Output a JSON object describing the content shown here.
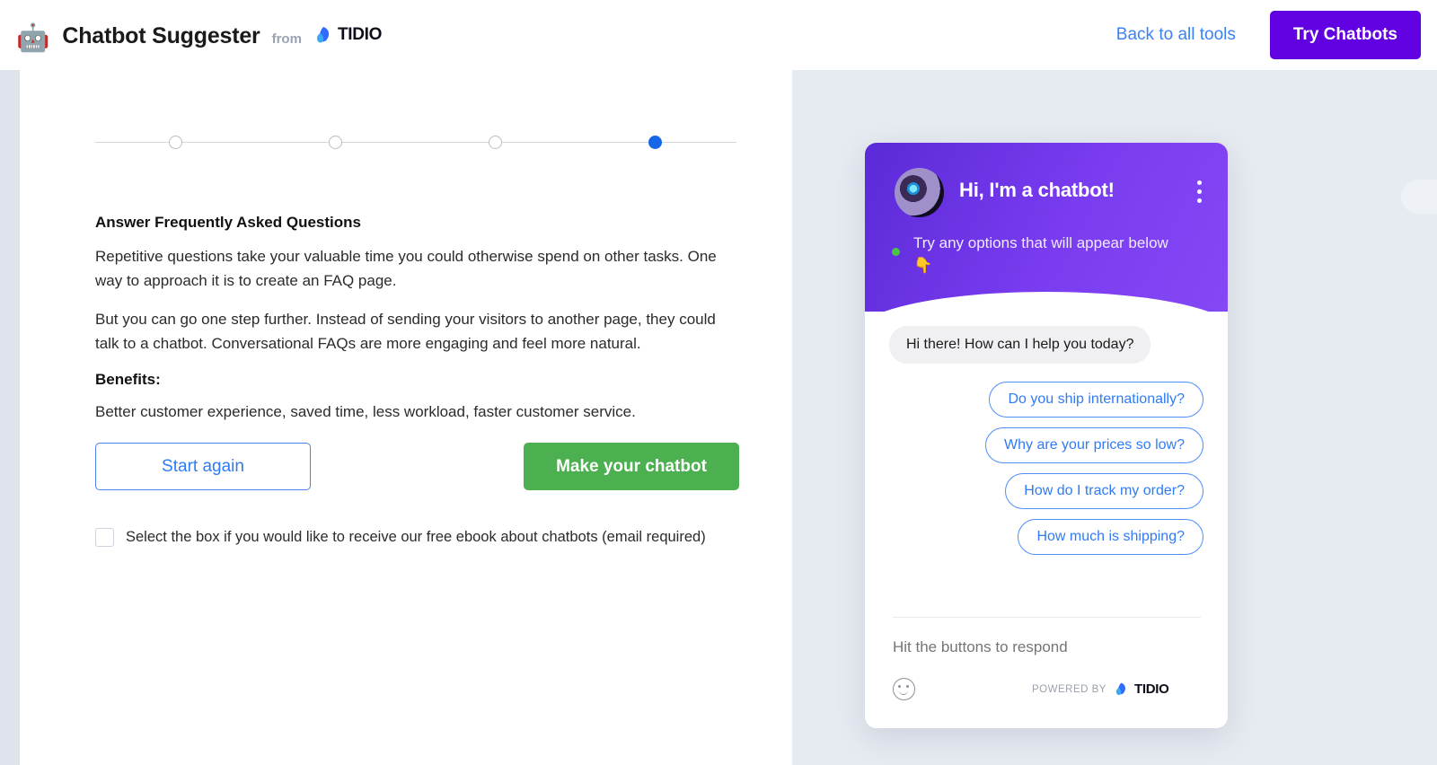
{
  "header": {
    "robot_icon": "robot-icon",
    "app_title": "Chatbot Suggester",
    "from_label": "from",
    "brand_name": "TIDIO",
    "back_link": "Back to all tools",
    "try_button": "Try Chatbots"
  },
  "stepper": {
    "steps": [
      {
        "index": 1,
        "active": false
      },
      {
        "index": 2,
        "active": false
      },
      {
        "index": 3,
        "active": false
      },
      {
        "index": 4,
        "active": true
      }
    ],
    "active_step": 4,
    "total_steps": 4
  },
  "main": {
    "clipped_text": "",
    "section_title": "Answer Frequently Asked Questions",
    "paragraph_1": "Repetitive questions take your valuable time you could otherwise spend on other tasks. One way to approach it is to create an FAQ page.",
    "paragraph_2": "But you can go one step further. Instead of sending your visitors to another page, they could talk to a chatbot. Conversational FAQs are more engaging and feel more natural.",
    "benefits_label": "Benefits:",
    "benefits_text": "Better customer experience, saved time, less workload, faster customer service.",
    "start_again_button": "Start again",
    "make_chatbot_button": "Make your chatbot",
    "checkbox_label": "Select the box if you would like to receive our free ebook about chatbots (email required)",
    "checkbox_checked": false
  },
  "widget": {
    "title": "Hi, I'm a chatbot!",
    "avatar": "chatbot-avatar",
    "kebab_icon": "kebab-menu-icon",
    "status": "online",
    "subline": "Try any options that will appear below",
    "hand_icon": "👇",
    "bot_message": "Hi there! How can I help you today?",
    "options": [
      "Do you ship internationally?",
      "Why are your prices so low?",
      "How do I track my order?",
      "How much is shipping?"
    ],
    "input_placeholder": "Hit the buttons to respond",
    "input_value": "",
    "emoji_icon": "emoji-smiley-icon",
    "powered_by_label": "POWERED BY",
    "powered_by_brand": "TIDIO",
    "send_icon": "send-paper-plane-icon"
  },
  "colors": {
    "accent_purple": "#6100e0",
    "link_blue": "#3b82f6",
    "success_green": "#4caf50",
    "widget_purple": "#7a3cf0",
    "option_blue": "#2f7bf6",
    "page_bg": "#e6eaf1"
  }
}
